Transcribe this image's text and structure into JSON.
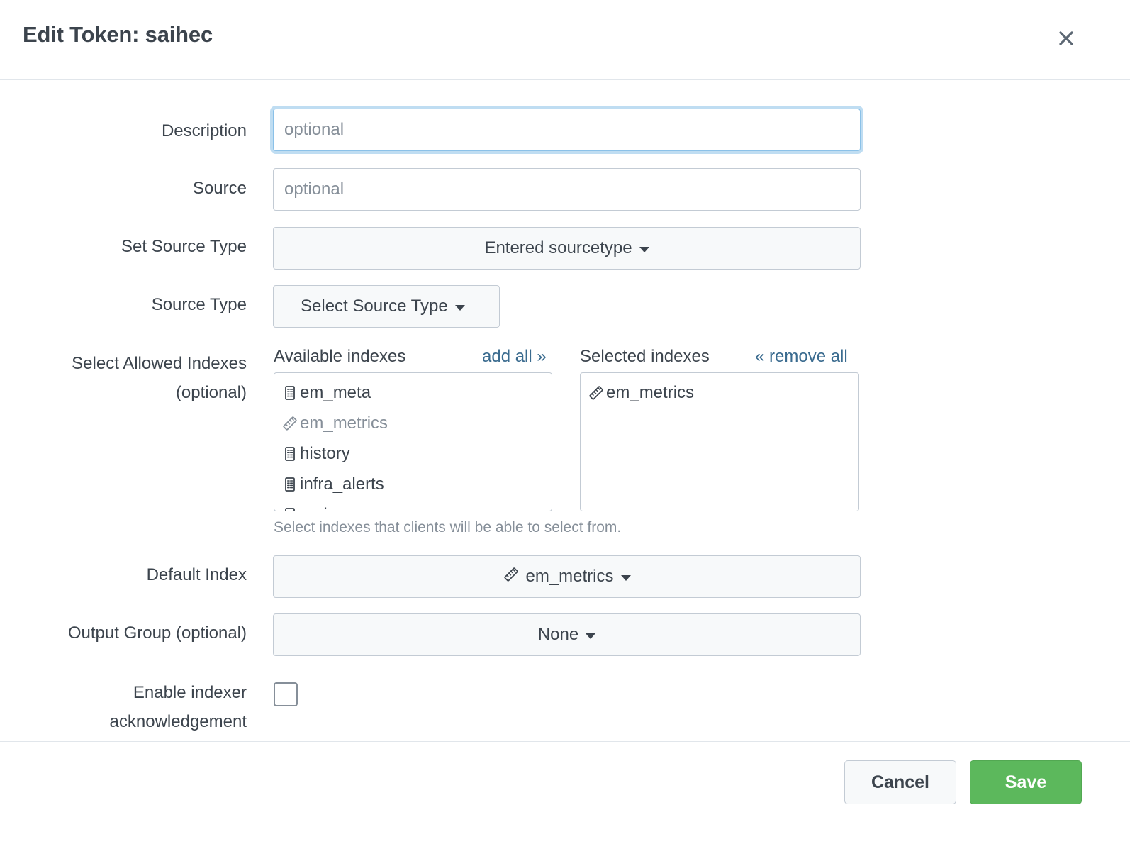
{
  "header": {
    "title": "Edit Token: saihec",
    "close_icon": "close-icon"
  },
  "form": {
    "description": {
      "label": "Description",
      "placeholder": "optional",
      "value": ""
    },
    "source": {
      "label": "Source",
      "placeholder": "optional",
      "value": ""
    },
    "set_source_type": {
      "label": "Set Source Type",
      "value": "Entered sourcetype"
    },
    "source_type": {
      "label": "Source Type",
      "value": "Select Source Type"
    },
    "allowed_indexes": {
      "label_line1": "Select Allowed Indexes",
      "label_line2": "(optional)",
      "available_header": "Available indexes",
      "add_all_link": "add all »",
      "selected_header": "Selected indexes",
      "remove_all_link": "« remove all",
      "available": [
        {
          "name": "em_meta",
          "icon": "event-index-icon",
          "disabled": false
        },
        {
          "name": "em_metrics",
          "icon": "metrics-index-icon",
          "disabled": true
        },
        {
          "name": "history",
          "icon": "event-index-icon",
          "disabled": false
        },
        {
          "name": "infra_alerts",
          "icon": "event-index-icon",
          "disabled": false
        },
        {
          "name": "main",
          "icon": "event-index-icon",
          "disabled": false
        }
      ],
      "selected": [
        {
          "name": "em_metrics",
          "icon": "metrics-index-icon",
          "disabled": false
        }
      ],
      "hint": "Select indexes that clients will be able to select from."
    },
    "default_index": {
      "label": "Default Index",
      "value": "em_metrics",
      "icon": "metrics-index-icon"
    },
    "output_group": {
      "label": "Output Group (optional)",
      "value": "None"
    },
    "indexer_ack": {
      "label_line1": "Enable indexer",
      "label_line2": "acknowledgement",
      "checked": false
    }
  },
  "footer": {
    "cancel_label": "Cancel",
    "save_label": "Save"
  },
  "colors": {
    "link": "#3a6b8f",
    "save_green": "#5cb85c",
    "focus_blue": "#8bc1e8",
    "text": "#3c444d",
    "muted": "#868f99",
    "border": "#c3cbd4"
  }
}
